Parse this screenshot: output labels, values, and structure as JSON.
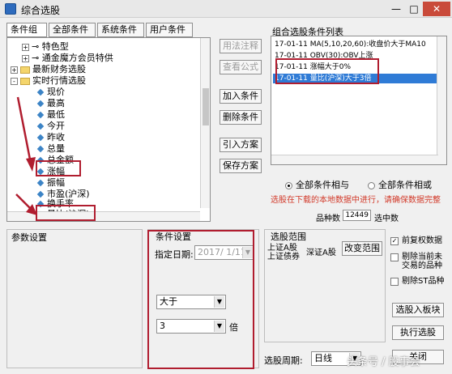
{
  "window": {
    "title": "综合选股",
    "minimize": "—",
    "maximize": "□",
    "close": "✕"
  },
  "tabs": [
    "条件组",
    "全部条件",
    "系统条件",
    "用户条件"
  ],
  "tree": [
    {
      "toggle": "+",
      "icon": "link",
      "label": "特色型"
    },
    {
      "toggle": "+",
      "icon": "link",
      "label": "通金魔方会员特供"
    },
    {
      "toggle": "+",
      "icon": "folder",
      "label": "最新财务选股"
    },
    {
      "toggle": "-",
      "icon": "folder",
      "label": "实时行情选股"
    },
    {
      "toggle": "",
      "icon": "diamond",
      "label": "现价"
    },
    {
      "toggle": "",
      "icon": "diamond",
      "label": "最高"
    },
    {
      "toggle": "",
      "icon": "diamond",
      "label": "最低"
    },
    {
      "toggle": "",
      "icon": "diamond",
      "label": "今开"
    },
    {
      "toggle": "",
      "icon": "diamond",
      "label": "昨收"
    },
    {
      "toggle": "",
      "icon": "diamond",
      "label": "总量"
    },
    {
      "toggle": "",
      "icon": "diamond",
      "label": "总金额"
    },
    {
      "toggle": "",
      "icon": "diamond",
      "label": "涨幅"
    },
    {
      "toggle": "",
      "icon": "diamond",
      "label": "振幅"
    },
    {
      "toggle": "",
      "icon": "diamond",
      "label": "市盈(沪深)"
    },
    {
      "toggle": "",
      "icon": "diamond",
      "label": "换手率"
    },
    {
      "toggle": "",
      "icon": "diamond",
      "label": "量比(沪深)"
    }
  ],
  "buttons": {
    "usage": "用法注释",
    "view_formula": "查看公式",
    "add": "加入条件",
    "delete": "删除条件",
    "import": "引入方案",
    "save": "保存方案",
    "change_range": "改变范围",
    "select_to_board": "选股入板块",
    "execute": "执行选股",
    "close": "关闭"
  },
  "condition_list": {
    "title": "组合选股条件列表",
    "items": [
      "17-01-11 MA(5,10,20,60):收盘价大于MA10",
      "17-01-11 OBV(30):OBV上涨",
      "17-01-11 涨幅大于0%",
      "17-01-11 量比(沪深)大于3倍"
    ],
    "selected_index": 3
  },
  "radios": {
    "all_and": "全部条件相与",
    "all_or": "全部条件相或"
  },
  "warning": "选股在下载的本地数据中进行，请确保数据完整",
  "counts": {
    "stock_count_label": "品种数",
    "stock_count": "12449",
    "selected_count_label": "选中数"
  },
  "params": {
    "title": "参数设置"
  },
  "condition_settings": {
    "title": "条件设置",
    "date_label": "指定日期:",
    "date_value": "2017/ 1/11",
    "operator": "大于",
    "value": "3",
    "unit": "倍"
  },
  "range": {
    "title": "选股范围",
    "main_board": "上证A股",
    "bond": "上证债券",
    "sz_a": "深证A股"
  },
  "options": [
    {
      "label": "前复权数据",
      "checked": true
    },
    {
      "label": "剔除当前未交易的品种",
      "checked": false
    },
    {
      "label": "剔除ST品种",
      "checked": false
    }
  ],
  "period": {
    "label": "选股周期:",
    "value": "日线"
  },
  "watermark": "头条号 / 股事会",
  "colors": {
    "selection": "#2f7bd6",
    "annotation": "#b01d2f",
    "warning": "#d23a2a"
  }
}
